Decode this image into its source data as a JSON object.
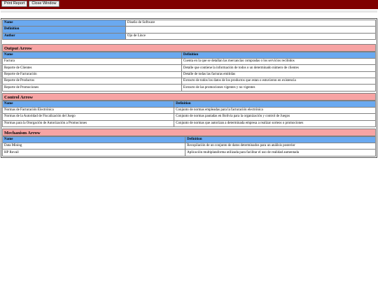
{
  "toolbar": {
    "print_label": "Print Report",
    "close_label": "Close Window"
  },
  "info": {
    "name_label": "Name",
    "name_value": "Diseño de Software",
    "definition_label": "Definition",
    "definition_value": "",
    "author_label": "Author",
    "author_value": "Ojo de Lince"
  },
  "output": {
    "title": "Output Arrow",
    "col_name": "Name",
    "col_def": "Definition",
    "rows": [
      {
        "name": "Factura",
        "def": "Cuenta en la que se detallan las mercancías compradas o los servicios recibidos"
      },
      {
        "name": "Reporte de Clientes",
        "def": "Detalle que contiene la información de todos o un determinado número de clientes"
      },
      {
        "name": "Reporte de Facturación",
        "def": "Detalle de todas las facturas emitidas"
      },
      {
        "name": "Reporte de Productos",
        "def": "Extracto de todos los datos de los productos que estan o estuvieron en existencia"
      },
      {
        "name": "Reporte de Promociones",
        "def": "Extracto de las promociones vigentes y no vigentes"
      }
    ]
  },
  "control": {
    "title": "Control Arrow",
    "col_name": "Name",
    "col_def": "Definition",
    "rows": [
      {
        "name": "Normas de Facturación Electrónica",
        "def": "Conjunto de normas empleadas para la facturación electrónica"
      },
      {
        "name": "Normas de la Autoridad de Fiscalización del Juego",
        "def": "Conjunto de normas pautadas en Bolivia para la organización y control de Juegos"
      },
      {
        "name": "Normas para la Otorgación de Autorización a Promociones",
        "def": "Conjunto de normas que autorizan a determinada empresa a realizar sorteos o promociones"
      }
    ]
  },
  "mechanism": {
    "title": "Mechanism Arrow",
    "col_name": "Name",
    "col_def": "Definition",
    "rows": [
      {
        "name": "Data Mining",
        "def": "Recopilación de un conjunto de datos determinados para un análisis posterior"
      },
      {
        "name": "HP Rovail",
        "def": "Aplicación multiplataforma utilizada para facilitar el uso de realidad aumentada"
      }
    ]
  }
}
